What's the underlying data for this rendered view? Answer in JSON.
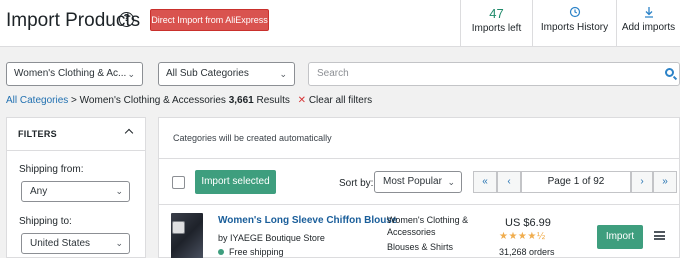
{
  "header": {
    "title": "Import Products",
    "help_icon": "?",
    "direct_import_label": "Direct Import from AliExpress",
    "imports_left_count": "47",
    "imports_left_label": "Imports left",
    "history_label": "Imports History",
    "add_label": "Add imports"
  },
  "filters_bar": {
    "category_value": "Women's Clothing & Ac...",
    "subcategory_value": "All Sub Categories",
    "search_placeholder": "Search"
  },
  "breadcrumb": {
    "root": "All Categories",
    "separator": ">",
    "current": "Women's Clothing & Accessories",
    "count": "3,661",
    "results_label": "Results",
    "clear_label": "Clear all filters"
  },
  "sidebar": {
    "heading": "FILTERS",
    "shipping_from_label": "Shipping from:",
    "shipping_from_value": "Any",
    "shipping_to_label": "Shipping to:",
    "shipping_to_value": "United States"
  },
  "main": {
    "info_text": "Categories will be created automatically",
    "import_selected_label": "Import selected",
    "sort_label": "Sort by:",
    "sort_value": "Most Popular",
    "pager": {
      "first": "«",
      "prev": "‹",
      "page_text": "Page 1 of 92",
      "next": "›",
      "last": "»"
    }
  },
  "product": {
    "title": "Women's Long Sleeve Chiffon Blouse",
    "store": "by IYAEGE Boutique Store",
    "shipping": "Free shipping",
    "category_line1": "Women's Clothing &",
    "category_line2": "Accessories",
    "subcategory": "Blouses & Shirts",
    "price": "US $6.99",
    "stars": "★★★★½",
    "rating": 4.5,
    "orders": "31,268 orders",
    "import_label": "Import"
  },
  "colors": {
    "accent_green": "#3e9e7e",
    "danger_red": "#d9534f",
    "link_blue": "#2271b1"
  },
  "icons": [
    "help-icon",
    "history-icon",
    "download-icon",
    "search-icon",
    "chevron-down-icon",
    "chevron-up-icon",
    "menu-icon",
    "close-icon"
  ]
}
